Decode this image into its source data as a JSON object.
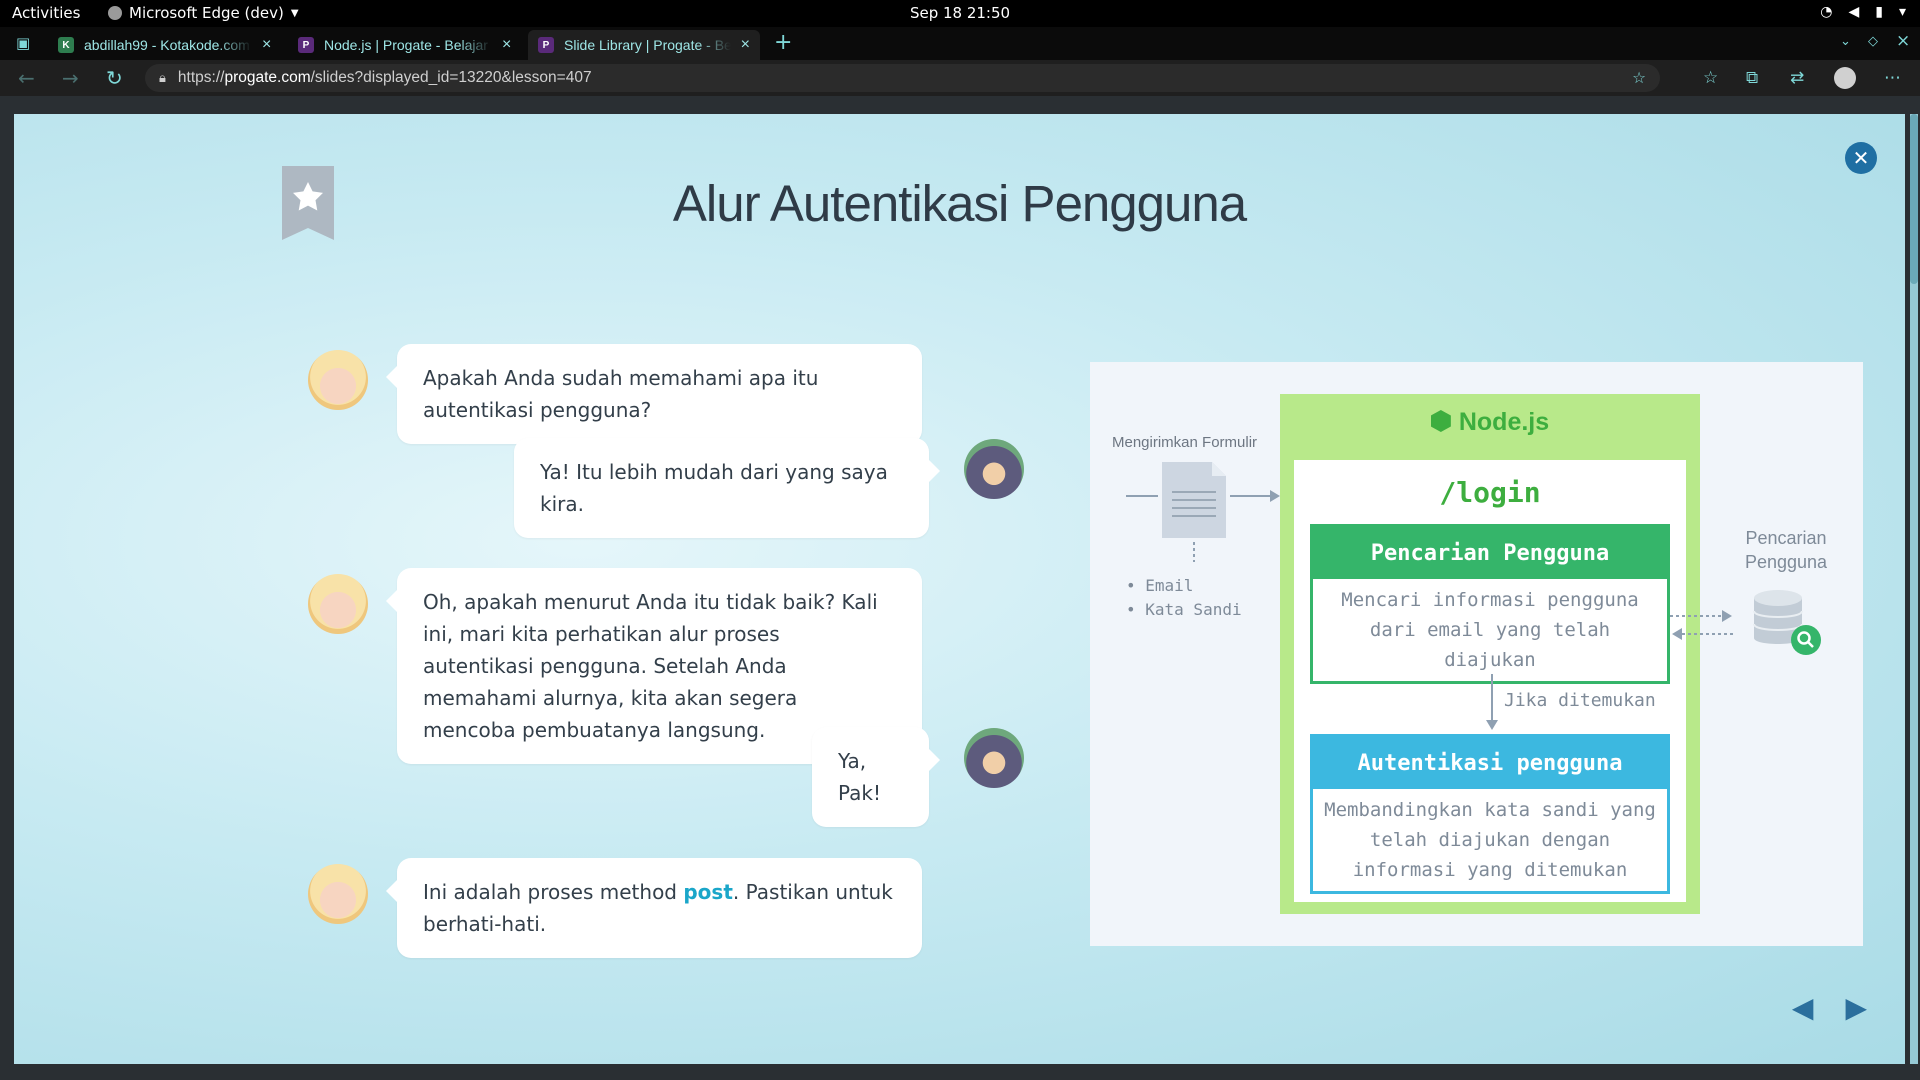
{
  "system": {
    "activities": "Activities",
    "app_name": "Microsoft Edge (dev)",
    "clock": "Sep 18  21:50"
  },
  "tabs": [
    {
      "title": "abdillah99 - Kotakode.com",
      "active": false
    },
    {
      "title": "Node.js | Progate - Belajar",
      "active": false
    },
    {
      "title": "Slide Library | Progate - Belajar",
      "active": true
    }
  ],
  "address": {
    "prefix": "https://",
    "host": "progate.com",
    "path": "/slides?displayed_id=13220&lesson=407"
  },
  "slide": {
    "title": "Alur Autentikasi Pengguna",
    "dialog": [
      {
        "speaker": "teacher",
        "text": "Apakah Anda sudah memahami apa itu autentikasi pengguna?"
      },
      {
        "speaker": "student",
        "text": "Ya! Itu lebih mudah dari yang saya kira."
      },
      {
        "speaker": "teacher",
        "text": "Oh, apakah menurut Anda itu tidak baik? Kali ini, mari kita perhatikan alur proses autentikasi pengguna. Setelah Anda memahami alurnya, kita akan segera mencoba pembuatanya langsung."
      },
      {
        "speaker": "student",
        "text": "Ya, Pak!"
      },
      {
        "speaker": "teacher",
        "text_before": "Ini adalah proses method ",
        "highlight": "post",
        "text_after": ". Pastikan untuk berhati-hati."
      }
    ],
    "diagram": {
      "form_label": "Mengirimkan Formulir",
      "fields": [
        "• Email",
        "• Kata Sandi"
      ],
      "server": "Node.js",
      "route": "/login",
      "step1": {
        "title": "Pencarian Pengguna",
        "body": "Mencari informasi pengguna dari email yang telah diajukan"
      },
      "condition": "Jika ditemukan",
      "step2": {
        "title": "Autentikasi pengguna",
        "body": "Membandingkan kata sandi yang telah diajukan dengan informasi yang ditemukan"
      },
      "db_label": "Pencarian Pengguna"
    }
  },
  "icons": {
    "bookmark": "bookmark-star-icon",
    "close": "close-circle-icon",
    "prev": "triangle-left-icon",
    "next": "triangle-right-icon"
  },
  "colors": {
    "accent": "#1aa6c9",
    "node_green": "#3dae3f",
    "step1": "#35b56a",
    "step2": "#3cb8e0"
  }
}
